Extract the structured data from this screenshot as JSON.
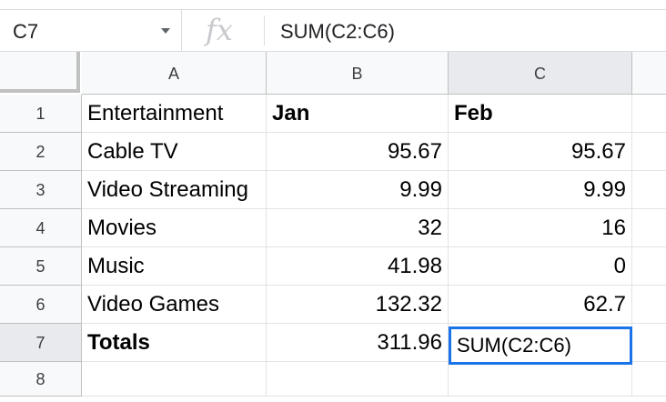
{
  "formula_bar": {
    "name_box": "C7",
    "fx_label": "fx",
    "formula": "SUM(C2:C6)"
  },
  "columns": [
    "A",
    "B",
    "C"
  ],
  "rows": [
    {
      "number": "1",
      "cells": [
        "Entertainment",
        "Jan",
        "Feb"
      ]
    },
    {
      "number": "2",
      "cells": [
        "Cable TV",
        "95.67",
        "95.67"
      ]
    },
    {
      "number": "3",
      "cells": [
        "Video Streaming",
        "9.99",
        "9.99"
      ]
    },
    {
      "number": "4",
      "cells": [
        "Movies",
        "32",
        "16"
      ]
    },
    {
      "number": "5",
      "cells": [
        "Music",
        "41.98",
        "0"
      ]
    },
    {
      "number": "6",
      "cells": [
        "Video Games",
        "132.32",
        "62.7"
      ]
    },
    {
      "number": "7",
      "cells": [
        "Totals",
        "311.96",
        "SUM(C2:C6)"
      ]
    },
    {
      "number": "8",
      "cells": [
        "",
        "",
        ""
      ]
    }
  ],
  "active_cell": {
    "ref": "C7",
    "editing_text": "SUM(C2:C6)"
  },
  "colors": {
    "selection_border": "#1a73e8",
    "header_bg": "#f8f9fa",
    "selected_header_bg": "#e8eaed"
  }
}
